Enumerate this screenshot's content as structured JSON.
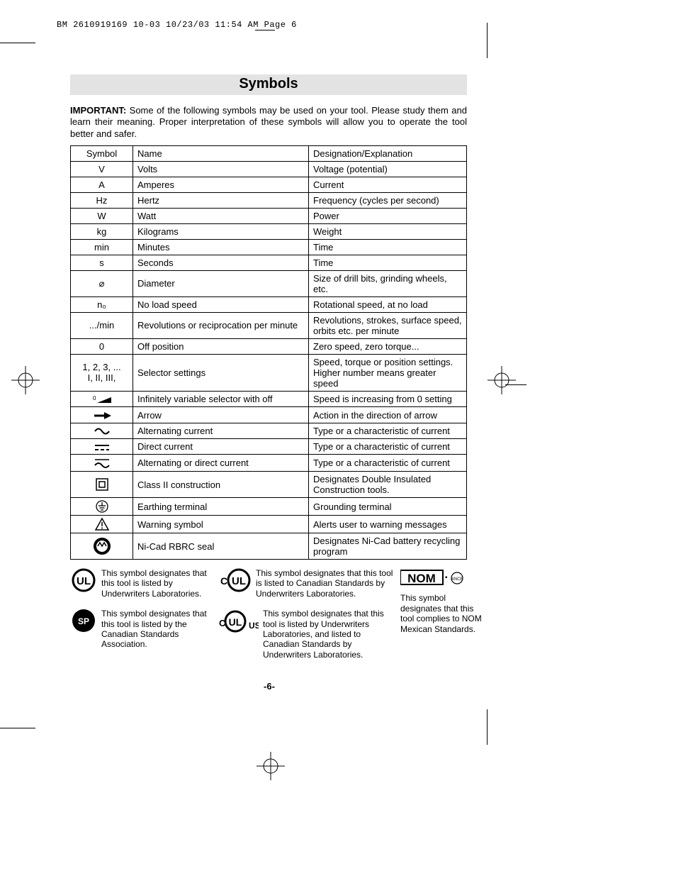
{
  "header": "BM 2610919169 10-03  10/23/03  11:54 AM  Page 6",
  "title": "Symbols",
  "intro_bold": "IMPORTANT:",
  "intro_text": " Some of the following symbols may be used on your tool.  Please study them and learn their meaning.  Proper interpretation of these symbols will allow you to operate the tool better and safer.",
  "table": {
    "head": {
      "c0": "Symbol",
      "c1": "Name",
      "c2": "Designation/Explanation"
    },
    "rows": [
      {
        "sym": "V",
        "name": "Volts",
        "desc": "Voltage (potential)"
      },
      {
        "sym": "A",
        "name": "Amperes",
        "desc": "Current"
      },
      {
        "sym": "Hz",
        "name": "Hertz",
        "desc": "Frequency (cycles per second)"
      },
      {
        "sym": "W",
        "name": "Watt",
        "desc": "Power"
      },
      {
        "sym": "kg",
        "name": "Kilograms",
        "desc": "Weight"
      },
      {
        "sym": "min",
        "name": "Minutes",
        "desc": "Time"
      },
      {
        "sym": "s",
        "name": "Seconds",
        "desc": "Time"
      },
      {
        "sym": "⌀",
        "name": "Diameter",
        "desc": "Size of drill bits, grinding wheels,  etc."
      },
      {
        "sym": "n₀",
        "name": "No load speed",
        "desc": "Rotational speed, at no load"
      },
      {
        "sym": ".../min",
        "name": "Revolutions or reciprocation per minute",
        "desc": "Revolutions, strokes, surface speed, orbits etc. per minute"
      },
      {
        "sym": "0",
        "name": "Off position",
        "desc": "Zero speed, zero torque..."
      },
      {
        "sym": "1, 2, 3, ...\nI, II, III,",
        "name": "Selector settings",
        "desc": "Speed, torque or position settings. Higher number means greater speed"
      },
      {
        "sym": "SVG:ramp",
        "name": "Infinitely variable selector with off",
        "desc": "Speed is increasing from 0 setting"
      },
      {
        "sym": "SVG:arrow",
        "name": "Arrow",
        "desc": "Action in the direction of arrow"
      },
      {
        "sym": "SVG:ac",
        "name": "Alternating current",
        "desc": "Type or a characteristic of current"
      },
      {
        "sym": "SVG:dc",
        "name": "Direct current",
        "desc": "Type or a characteristic of current"
      },
      {
        "sym": "SVG:acdc",
        "name": "Alternating or direct current",
        "desc": "Type or a characteristic of current"
      },
      {
        "sym": "SVG:class2",
        "name": "Class II  construction",
        "desc": "Designates Double Insulated Construction tools."
      },
      {
        "sym": "SVG:earth",
        "name": "Earthing terminal",
        "desc": "Grounding terminal"
      },
      {
        "sym": "SVG:warn",
        "name": "Warning symbol",
        "desc": "Alerts user to warning messages"
      },
      {
        "sym": "SVG:rbrc",
        "name": "Ni-Cad RBRC seal",
        "desc": "Designates Ni-Cad battery recycling program"
      }
    ]
  },
  "certs": {
    "ul": "This symbol designates that this tool is listed by Underwriters Laboratories.",
    "cul": "This symbol designates that this tool is listed to Canadian Standards by Underwriters Laboratories.",
    "csa": "This symbol designates that this tool is listed by the Canadian Standards Association.",
    "culus": "This symbol designates that this tool is listed by Underwriters Laboratories, and listed to Canadian Standards by Underwriters Laboratories.",
    "nom": "This symbol designates that this tool complies to NOM Mexican Standards."
  },
  "page_number": "-6-"
}
